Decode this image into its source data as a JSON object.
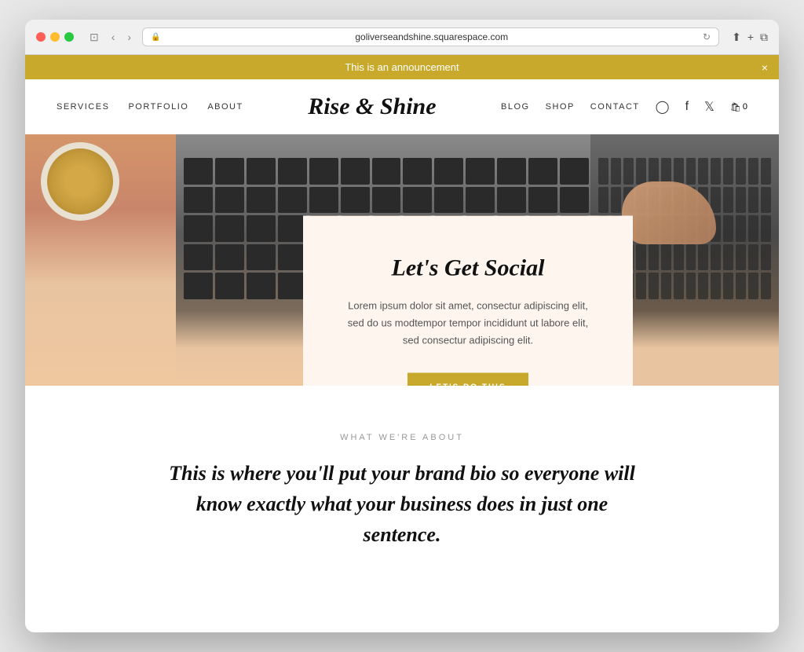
{
  "browser": {
    "url": "goliverseandshine.squarespace.com",
    "back_btn": "‹",
    "forward_btn": "›",
    "reload_btn": "↻",
    "share_btn": "⬆",
    "new_tab_btn": "+",
    "tile_btn": "⧉"
  },
  "announcement": {
    "text": "This is an announcement",
    "close_label": "×"
  },
  "nav": {
    "logo": "Rise & Shine",
    "left_links": [
      {
        "label": "SERVICES"
      },
      {
        "label": "PORTFOLIO"
      },
      {
        "label": "ABOUT"
      }
    ],
    "right_links": [
      {
        "label": "BLOG"
      },
      {
        "label": "SHOP"
      },
      {
        "label": "CONTACT"
      }
    ],
    "social_icons": [
      "instagram",
      "facebook",
      "twitter"
    ],
    "cart_count": "0"
  },
  "hero": {
    "social_card": {
      "title": "Let's Get Social",
      "body": "Lorem ipsum dolor sit amet, consectur adipiscing elit, sed do us modtempor tempor incididunt ut labore elit, sed consectur adipiscing elit.",
      "cta_label": "LET'S DO THIS"
    }
  },
  "about": {
    "label": "WHAT WE'RE ABOUT",
    "heading": "This is where you'll put your brand bio so everyone will know exactly what your business does in just one sentence."
  }
}
